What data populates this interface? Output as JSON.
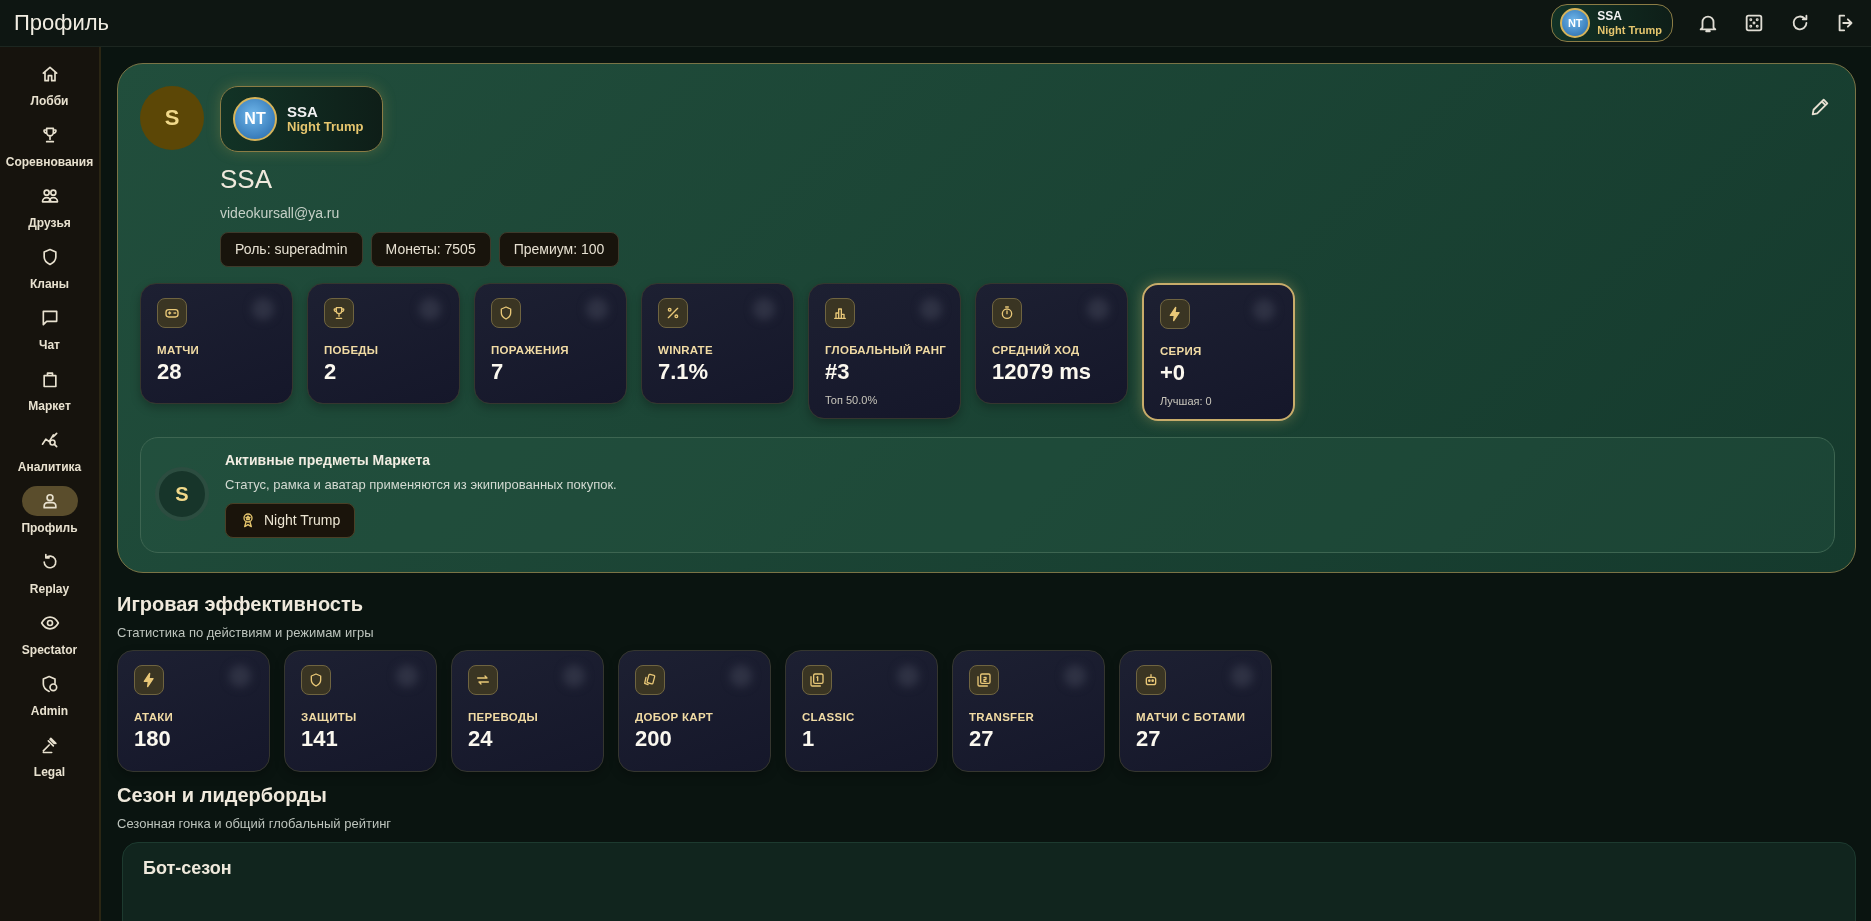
{
  "topbar": {
    "title": "Профиль",
    "user_chip": {
      "emblem": "NT",
      "name": "SSA",
      "status": "Night Trump"
    }
  },
  "sidebar": {
    "items": [
      {
        "label": "Лобби",
        "selected": false
      },
      {
        "label": "Соревнования",
        "selected": false
      },
      {
        "label": "Друзья",
        "selected": false
      },
      {
        "label": "Кланы",
        "selected": false
      },
      {
        "label": "Чат",
        "selected": false
      },
      {
        "label": "Маркет",
        "selected": false
      },
      {
        "label": "Аналитика",
        "selected": false
      },
      {
        "label": "Профиль",
        "selected": true
      },
      {
        "label": "Replay",
        "selected": false
      },
      {
        "label": "Spectator",
        "selected": false
      },
      {
        "label": "Admin",
        "selected": false
      },
      {
        "label": "Legal",
        "selected": false
      }
    ]
  },
  "profile": {
    "avatar": "S",
    "chip": {
      "emblem": "NT",
      "name": "SSA",
      "status": "Night Trump"
    },
    "name": "SSA",
    "email": "videokursall@ya.ru",
    "tags": [
      "Роль: superadmin",
      "Монеты: 7505",
      "Премиум: 100"
    ],
    "stats": [
      {
        "label": "МАТЧИ",
        "value": "28",
        "highlighted": false
      },
      {
        "label": "ПОБЕДЫ",
        "value": "2",
        "highlighted": false
      },
      {
        "label": "ПОРАЖЕНИЯ",
        "value": "7",
        "highlighted": false
      },
      {
        "label": "WINRATE",
        "value": "7.1%",
        "highlighted": false
      },
      {
        "label": "ГЛОБАЛЬНЫЙ РАНГ",
        "value": "#3",
        "note": "Топ 50.0%",
        "highlighted": false
      },
      {
        "label": "СРЕДНИЙ ХОД",
        "value": "12079 ms",
        "highlighted": false
      },
      {
        "label": "СЕРИЯ",
        "value": "+0",
        "note": "Лучшая: 0",
        "highlighted": true
      }
    ],
    "market": {
      "avatar": "S",
      "title": "Активные предметы Маркета",
      "description": "Статус, рамка и аватар применяются из экипированных покупок.",
      "items": [
        "Night Trump"
      ]
    }
  },
  "performance": {
    "title": "Игровая эффективность",
    "subtitle": "Статистика по действиям и режимам игры",
    "stats": [
      {
        "label": "АТАКИ",
        "value": "180"
      },
      {
        "label": "ЗАЩИТЫ",
        "value": "141"
      },
      {
        "label": "ПЕРЕВОДЫ",
        "value": "24"
      },
      {
        "label": "ДОБОР КАРТ",
        "value": "200"
      },
      {
        "label": "CLASSIC",
        "value": "1"
      },
      {
        "label": "TRANSFER",
        "value": "27"
      },
      {
        "label": "МАТЧИ С БОТАМИ",
        "value": "27"
      }
    ]
  },
  "season": {
    "title": "Сезон и лидерборды",
    "subtitle": "Сезонная гонка и общий глобальный рейтинг",
    "card_title": "Бот-сезон"
  }
}
